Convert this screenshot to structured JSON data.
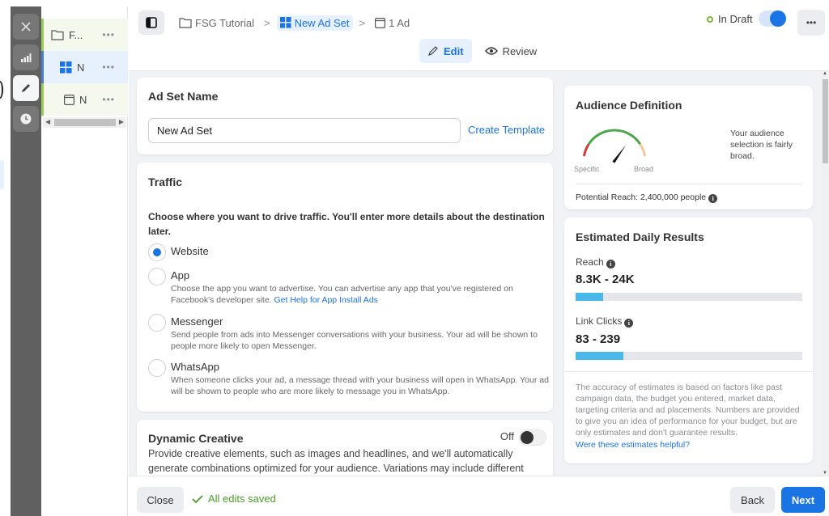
{
  "rail": {
    "items": [
      {
        "icon": "close-icon"
      },
      {
        "icon": "bar-chart-icon"
      },
      {
        "icon": "pencil-icon",
        "active": true
      },
      {
        "icon": "clock-icon"
      }
    ]
  },
  "tree": {
    "items": [
      {
        "label": "F...",
        "more": "•••",
        "type": "campaign"
      },
      {
        "label": "N",
        "more": "•••",
        "type": "ad-set"
      },
      {
        "label": "N",
        "more": "•••",
        "type": "ad"
      }
    ]
  },
  "header": {
    "breadcrumbs": [
      {
        "label": "FSG Tutorial",
        "icon": "folder-icon"
      },
      {
        "label": "New Ad Set",
        "icon": "grid-icon",
        "active": true
      },
      {
        "label": "1 Ad",
        "icon": "ad-icon"
      }
    ],
    "separator": ">",
    "status": "In Draft",
    "more": "•••",
    "tabs": [
      {
        "label": "Edit",
        "active": true
      },
      {
        "label": "Review"
      }
    ]
  },
  "ad_set_name": {
    "title": "Ad Set Name",
    "value": "New Ad Set",
    "create_template": "Create Template"
  },
  "traffic": {
    "title": "Traffic",
    "prompt": "Choose where you want to drive traffic. You'll enter more details about the destination later.",
    "options": [
      {
        "label": "Website",
        "checked": true,
        "desc": "",
        "link": ""
      },
      {
        "label": "App",
        "checked": false,
        "desc": "Choose the app you want to advertise. You can advertise any app that you've registered on Facebook's developer site. ",
        "link": "Get Help for App Install Ads"
      },
      {
        "label": "Messenger",
        "checked": false,
        "desc": "Send people from ads into Messenger conversations with your business. Your ad will be shown to people more likely to open Messenger.",
        "link": ""
      },
      {
        "label": "WhatsApp",
        "checked": false,
        "desc": "When someone clicks your ad, a message thread with your business will open in WhatsApp. Your ad will be shown to people who are more likely to message you in WhatsApp.",
        "link": ""
      }
    ]
  },
  "dynamic_creative": {
    "title": "Dynamic Creative",
    "toggle_label": "Off",
    "desc": "Provide creative elements, such as images and headlines, and we'll automatically generate combinations optimized for your audience. Variations may include different"
  },
  "audience": {
    "title": "Audience Definition",
    "gauge_low": "Specific",
    "gauge_high": "Broad",
    "gauge_level": 0.72,
    "summary": "Your audience selection is fairly broad.",
    "potential_reach": "Potential Reach: 2,400,000 people"
  },
  "estimates": {
    "title": "Estimated Daily Results",
    "metrics": [
      {
        "label": "Reach",
        "value": "8.3K - 24K",
        "fill": 0.12
      },
      {
        "label": "Link Clicks",
        "value": "83 - 239",
        "fill": 0.21
      }
    ],
    "disclaimer": "The accuracy of estimates is based on factors like past campaign data, the budget you entered, market data, targeting criteria and ad placements. Numbers are provided to give you an idea of performance for your budget, but are only estimates and don't guarantee results.",
    "feedback_link": "Were these estimates helpful?"
  },
  "footer": {
    "close": "Close",
    "saved": "All edits saved",
    "back": "Back",
    "next": "Next"
  },
  "colors": {
    "accent": "#1b74e4",
    "success": "#4a9d2a",
    "bar": "#4ab8e8"
  }
}
